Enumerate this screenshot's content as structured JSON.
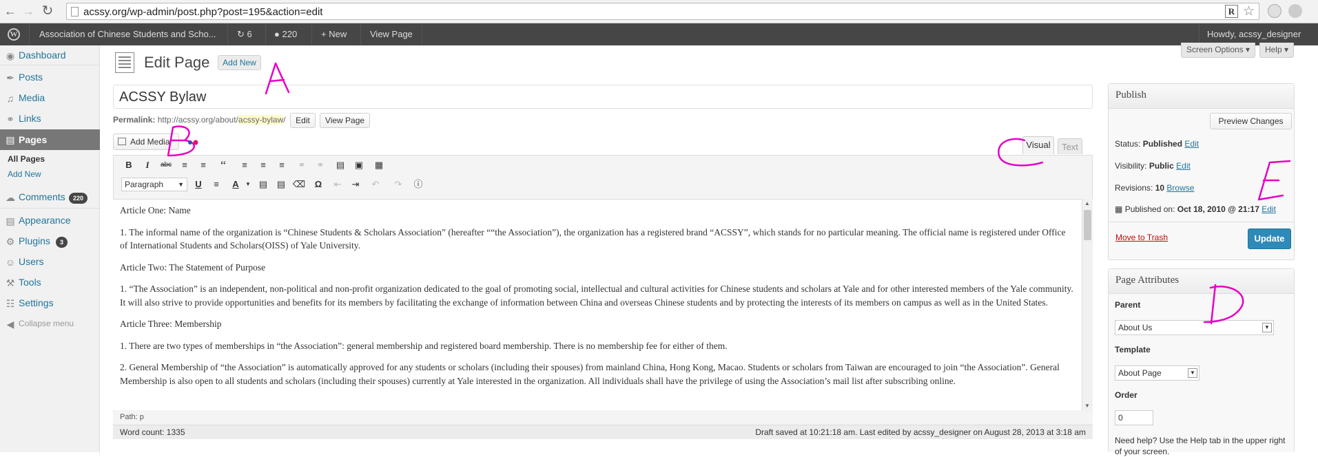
{
  "browser": {
    "url": "acssy.org/wp-admin/post.php?post=195&action=edit"
  },
  "adminbar": {
    "site_name": "Association of Chinese Students and Scho...",
    "updates_count": "6",
    "comments_count": "220",
    "new_label": "New",
    "view_page": "View Page",
    "howdy": "Howdy, acssy_designer"
  },
  "sidebar": {
    "items": [
      {
        "label": "Dashboard"
      },
      {
        "label": "Posts"
      },
      {
        "label": "Media"
      },
      {
        "label": "Links"
      },
      {
        "label": "Pages"
      },
      {
        "label": "Comments",
        "badge": "220"
      },
      {
        "label": "Appearance"
      },
      {
        "label": "Plugins",
        "badge": "3"
      },
      {
        "label": "Users"
      },
      {
        "label": "Tools"
      },
      {
        "label": "Settings"
      },
      {
        "label": "Collapse menu"
      }
    ],
    "submenu": [
      "All Pages",
      "Add New"
    ]
  },
  "header": {
    "title": "Edit Page",
    "add_new": "Add New",
    "screen_options": "Screen Options",
    "help": "Help"
  },
  "post": {
    "title": "ACSSY Bylaw",
    "permalink_label": "Permalink:",
    "permalink_base": "http://acssy.org/about/",
    "permalink_slug": "acssy-bylaw",
    "permalink_trail": "/",
    "edit_btn": "Edit",
    "view_btn": "View Page"
  },
  "editor": {
    "add_media": "Add Media",
    "tab_visual": "Visual",
    "tab_text": "Text",
    "format_select": "Paragraph",
    "paragraphs": [
      "Article One: Name",
      "1. The informal name of the organization is “Chinese Students & Scholars Association” (hereafter ““the Association”), the organization has a registered brand “ACSSY”, which stands for no particular meaning. The official name is registered under Office of International Students and Scholars(OISS) of Yale University.",
      "Article Two: The Statement of Purpose",
      "1. “The Association” is an independent, non-political and non-profit organization dedicated to the goal of promoting social, intellectual and cultural activities for Chinese students and scholars at Yale and for other interested members of the Yale community. It will also strive to provide opportunities and benefits for its members by facilitating the exchange of information between China and overseas Chinese students and by protecting the interests of its members on campus as well as in the United States.",
      "Article Three: Membership",
      "1. There are two types of memberships in “the Association”: general membership and registered board membership. There is no membership fee for either of them.",
      "2. General Membership of “the Association” is automatically approved for any students or scholars (including their spouses) from mainland China, Hong Kong, Macao. Students or scholars from Taiwan are encouraged to join “the Association”. General Membership is also open to all students and scholars (including their spouses) currently at Yale interested in the organization. All individuals shall have the privilege of using the Association’s mail list after subscribing online."
    ],
    "path": "Path: p",
    "word_count": "Word count: 1335",
    "draft_status": "Draft saved at 10:21:18 am. Last edited by acssy_designer on August 28, 2013 at 3:18 am"
  },
  "publish": {
    "title": "Publish",
    "preview": "Preview Changes",
    "status_label": "Status:",
    "status_value": "Published",
    "visibility_label": "Visibility:",
    "visibility_value": "Public",
    "revisions_label": "Revisions:",
    "revisions_value": "10",
    "browse": "Browse",
    "published_on_label": "Published on:",
    "published_on_value": "Oct 18, 2010 @ 21:17",
    "edit": "Edit",
    "trash": "Move to Trash",
    "update": "Update"
  },
  "attributes": {
    "title": "Page Attributes",
    "parent_label": "Parent",
    "parent_value": "About Us",
    "template_label": "Template",
    "template_value": "About Page",
    "order_label": "Order",
    "order_value": "0",
    "help_text": "Need help? Use the Help tab in the upper right of your screen."
  },
  "annotations": [
    "A",
    "B",
    "C",
    "D",
    "E"
  ],
  "colors": {
    "annotation": "#e600c8",
    "link": "#21759b",
    "active_menu": "#777777"
  }
}
